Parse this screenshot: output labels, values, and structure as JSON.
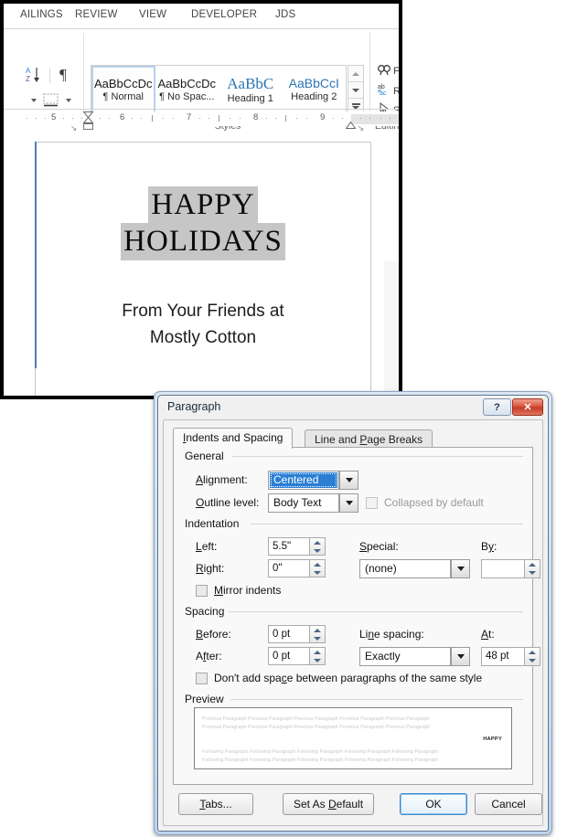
{
  "word": {
    "ribbon_tabs": [
      "AILINGS",
      "REVIEW",
      "VIEW",
      "DEVELOPER",
      "JDS"
    ],
    "groups": {
      "styles_label": "Styles",
      "editing_label": "Editing",
      "paragraph_launcher": "↘"
    },
    "styles": [
      {
        "sample": "AaBbCcDc",
        "name": "¶ Normal",
        "selected": true
      },
      {
        "sample": "AaBbCcDc",
        "name": "¶ No Spac...",
        "selected": false
      },
      {
        "sample": "AaBbC",
        "name": "Heading 1",
        "selected": false
      },
      {
        "sample": "AaBbCcI",
        "name": "Heading 2",
        "selected": false
      }
    ],
    "editing_items": [
      "Fi",
      "Re",
      "Se"
    ],
    "editing_full": [
      "Find",
      "Replace",
      "Select"
    ],
    "ruler_numbers": [
      "5",
      "6",
      "7",
      "8",
      "9"
    ],
    "document": {
      "wordart_line1": "HAPPY",
      "wordart_line2": "HOLIDAYS",
      "subtitle_line1": "From Your Friends at",
      "subtitle_line2": "Mostly Cotton"
    }
  },
  "dialog": {
    "title": "Paragraph",
    "help_label": "?",
    "close_label": "✕",
    "tabs": [
      {
        "label": "Indents and Spacing",
        "active": true
      },
      {
        "label": "Line and Page Breaks",
        "active": false
      }
    ],
    "general": {
      "title": "General",
      "alignment_label": "Alignment:",
      "alignment_value": "Centered",
      "outline_label": "Outline level:",
      "outline_value": "Body Text",
      "collapsed_label": "Collapsed by default",
      "collapsed_checked": false
    },
    "indentation": {
      "title": "Indentation",
      "left_label": "Left:",
      "left_value": "5.5\"",
      "right_label": "Right:",
      "right_value": "0\"",
      "special_label": "Special:",
      "special_value": "(none)",
      "by_label": "By:",
      "by_value": "",
      "mirror_label": "Mirror indents",
      "mirror_checked": false
    },
    "spacing": {
      "title": "Spacing",
      "before_label": "Before:",
      "before_value": "0 pt",
      "after_label": "After:",
      "after_value": "0 pt",
      "line_spacing_label": "Line spacing:",
      "line_spacing_value": "Exactly",
      "at_label": "At:",
      "at_value": "48 pt",
      "dont_add_label": "Don't add space between paragraphs of the same style",
      "dont_add_checked": false
    },
    "preview": {
      "title": "Preview",
      "previous_line": "Previous Paragraph Previous Paragraph Previous Paragraph Previous Paragraph Previous Paragraph",
      "sample_text": "HAPPY",
      "following_line": "Following Paragraph Following Paragraph Following Paragraph Following Paragraph Following Paragraph"
    },
    "buttons": {
      "tabs": "Tabs...",
      "set_as_default": "Set As Default",
      "ok": "OK",
      "cancel": "Cancel"
    }
  },
  "colors": {
    "accent": "#2a7fd4",
    "heading_blue": "#2e74b5",
    "highlight_gray": "#c6c6c6",
    "close_red": "#c33a26"
  }
}
